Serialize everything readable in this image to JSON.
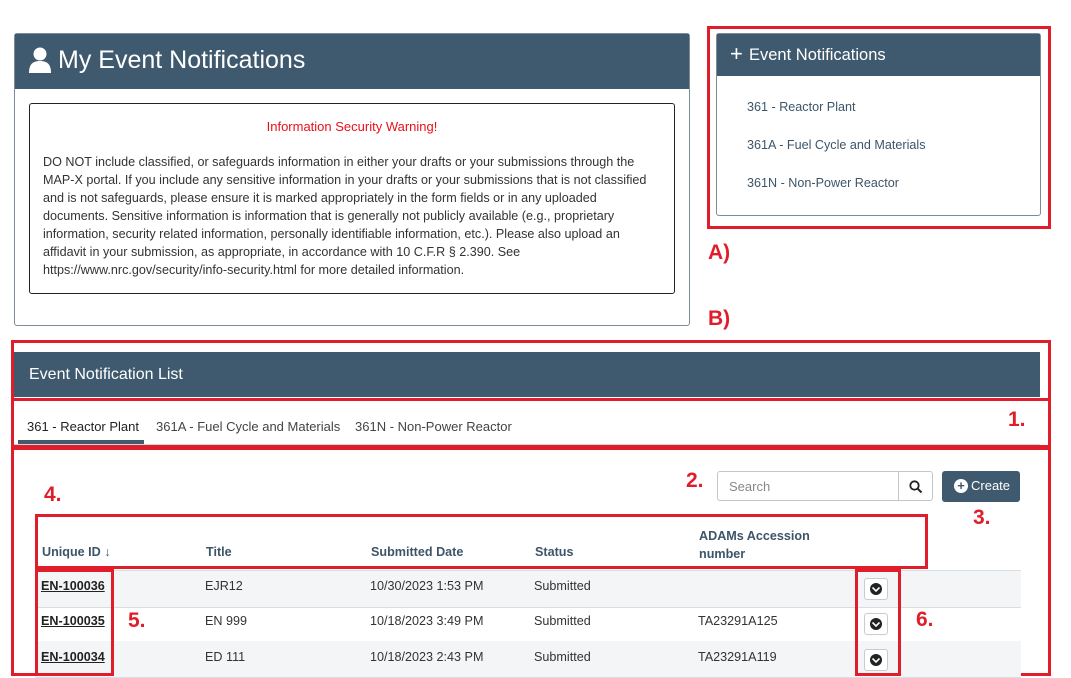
{
  "my_panel": {
    "title": "My Event Notifications",
    "warning_title": "Information Security Warning!",
    "warning_text": "DO NOT include classified, or safeguards information in either your drafts or your submissions through the MAP-X portal. If you include any sensitive information in your drafts or your submissions that is not classified and is not safeguards, please ensure it is marked appropriately in the form fields or in any uploaded documents. Sensitive information is information that is generally not publicly available (e.g., proprietary information, security related information, personally identifiable information, etc.). Please also upload an affidavit in your submission, as appropriate, in accordance with 10 C.F.R § 2.390. See https://www.nrc.gov/security/info-security.html for more detailed information."
  },
  "event_panel": {
    "title": "Event Notifications",
    "links": [
      "361 - Reactor Plant",
      "361A - Fuel Cycle and Materials",
      "361N - Non-Power Reactor"
    ]
  },
  "annotations": {
    "a": "A)",
    "b": "B)",
    "n1": "1.",
    "n2": "2.",
    "n3": "3.",
    "n4": "4.",
    "n5": "5.",
    "n6": "6."
  },
  "list": {
    "title": "Event Notification List",
    "tabs": [
      "361 - Reactor Plant",
      "361A - Fuel Cycle and Materials",
      "361N - Non-Power Reactor"
    ],
    "active_tab": 0,
    "search_placeholder": "Search",
    "create_label": "Create",
    "columns": [
      "Unique ID",
      "Title",
      "Submitted Date",
      "Status",
      "ADAMs Accession number"
    ],
    "sort_indicator": "↓",
    "rows": [
      {
        "uid": "EN-100036",
        "title": "EJR12",
        "date": "10/30/2023 1:53 PM",
        "status": "Submitted",
        "adams": ""
      },
      {
        "uid": "EN-100035",
        "title": "EN 999",
        "date": "10/18/2023 3:49 PM",
        "status": "Submitted",
        "adams": "TA23291A125"
      },
      {
        "uid": "EN-100034",
        "title": "ED 111",
        "date": "10/18/2023 2:43 PM",
        "status": "Submitted",
        "adams": "TA23291A119"
      }
    ]
  },
  "colors": {
    "header_bg": "#3f5a6e",
    "annotation_red": "#e01e2b",
    "warning_red": "#e8101a"
  }
}
